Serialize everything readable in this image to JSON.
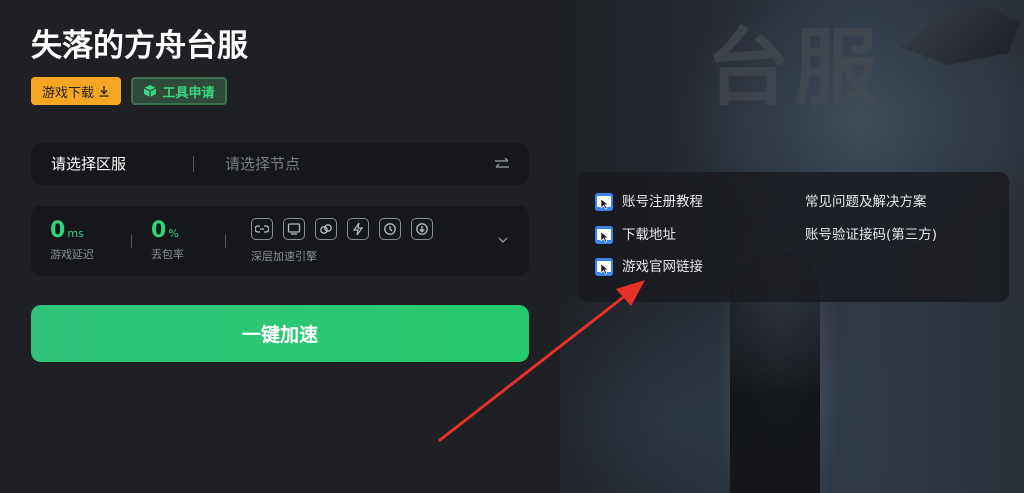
{
  "header": {
    "title": "失落的方舟台服",
    "download_label": "游戏下载",
    "tool_label": "工具申请"
  },
  "background": {
    "overlay_text": "台服"
  },
  "node_selector": {
    "region_label": "请选择区服",
    "node_placeholder": "请选择节点"
  },
  "stats": {
    "latency": {
      "value": "0",
      "unit": "ms",
      "label": "游戏延迟"
    },
    "packet_loss": {
      "value": "0",
      "unit": "%",
      "label": "丢包率"
    },
    "engine_label": "深层加速引擎",
    "engine_icons": [
      "link-icon",
      "screen-icon",
      "ring-icon",
      "lightning-icon",
      "clock-icon",
      "arrow-down-circle-icon"
    ]
  },
  "accelerate_button": {
    "label": "一键加速"
  },
  "links": {
    "left": [
      "账号注册教程",
      "下载地址",
      "游戏官网链接"
    ],
    "right": [
      "常见问题及解决方案",
      "账号验证接码(第三方)"
    ]
  },
  "colors": {
    "accent_green": "#33d17a",
    "download_orange": "#f5a623",
    "link_icon_blue": "#3d84e8",
    "arrow_red": "#e8302a"
  }
}
